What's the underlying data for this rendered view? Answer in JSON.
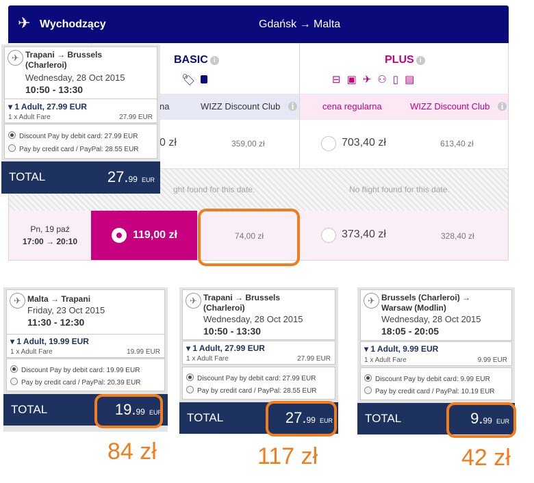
{
  "header": {
    "title": "Wychodzący",
    "route": "Gdańsk → Malta",
    "plane_icon": "airplane-icon"
  },
  "fares": {
    "basic": {
      "name": "BASIC",
      "color": "#0a0a7a",
      "icons": [
        "tag-icon",
        "bag-icon"
      ]
    },
    "plus": {
      "name": "PLUS",
      "color": "#c6007e",
      "icons": [
        "seat-icon",
        "seat-icon",
        "plane-icon",
        "family-icon",
        "suitcase-icon",
        "luggage-icon"
      ]
    },
    "basic_regular_partial": "na",
    "club_label": "WIZZ Discount Club",
    "regular_label": "cena regularna"
  },
  "rows": [
    {
      "basic_regular_partial": "0 zł",
      "basic_club": "359,00 zł",
      "plus_regular": "703,40 zł",
      "plus_club": "613,40 zł"
    },
    {
      "no_flight_basic": "ght found for this date.",
      "no_flight_plus": "No flight found for this date."
    },
    {
      "day": "Pn, 19 paź",
      "time": "17:00 → 20:10",
      "basic_regular": "119,00 zł",
      "basic_club": "74,00 zł",
      "plus_regular": "373,40 zł",
      "plus_club": "328,40 zł"
    }
  ],
  "cards": [
    {
      "route1": "Trapani → Brussels",
      "route2": "(Charleroi)",
      "date": "Wednesday, 28 Oct 2015",
      "time": "10:50 - 13:30",
      "pax": "▾ 1 Adult, 27.99 EUR",
      "fare_label": "1 x Adult Fare",
      "fare_value": "27.99 EUR",
      "opt1": "Discount Pay by debit card: 27.99 EUR",
      "opt2": "Pay by credit card / PayPal: 28.55 EUR",
      "total_label": "TOTAL",
      "total_main": "27.",
      "total_cents": "99",
      "total_cur": "EUR"
    },
    {
      "route1": "Malta → Trapani",
      "route2": "",
      "date": "Friday, 23 Oct 2015",
      "time": "11:30 - 12:30",
      "pax": "▾ 1 Adult, 19.99 EUR",
      "fare_label": "1 x Adult Fare",
      "fare_value": "19.99 EUR",
      "opt1": "Discount Pay by debit card: 19.99 EUR",
      "opt2": "Pay by credit card / PayPal: 20.39 EUR",
      "total_label": "TOTAL",
      "total_main": "19.",
      "total_cents": "99",
      "total_cur": "EUR",
      "annotation": "84 zł"
    },
    {
      "route1": "Trapani → Brussels",
      "route2": "(Charleroi)",
      "date": "Wednesday, 28 Oct 2015",
      "time": "10:50 - 13:30",
      "pax": "▾ 1 Adult, 27.99 EUR",
      "fare_label": "1 x Adult Fare",
      "fare_value": "27.99 EUR",
      "opt1": "Discount Pay by debit card: 27.99 EUR",
      "opt2": "Pay by credit card / PayPal: 28.55 EUR",
      "total_label": "TOTAL",
      "total_main": "27.",
      "total_cents": "99",
      "total_cur": "EUR",
      "annotation": "117 zł"
    },
    {
      "route1": "Brussels (Charleroi) →",
      "route2": "Warsaw (Modlin)",
      "date": "Wednesday, 28 Oct 2015",
      "time": "18:05 - 20:05",
      "pax": "▾ 1 Adult, 9.99 EUR",
      "fare_label": "1 x Adult Fare",
      "fare_value": "9.99 EUR",
      "opt1": "Discount Pay by debit card: 9.99 EUR",
      "opt2": "Pay by credit card / PayPal: 10.19 EUR",
      "total_label": "TOTAL",
      "total_main": "9.",
      "total_cents": "99",
      "total_cur": "EUR",
      "annotation": "42 zł"
    }
  ],
  "accent": "#f07d1e",
  "selected_color": "#c6007e",
  "total_bar_color": "#1e3260"
}
